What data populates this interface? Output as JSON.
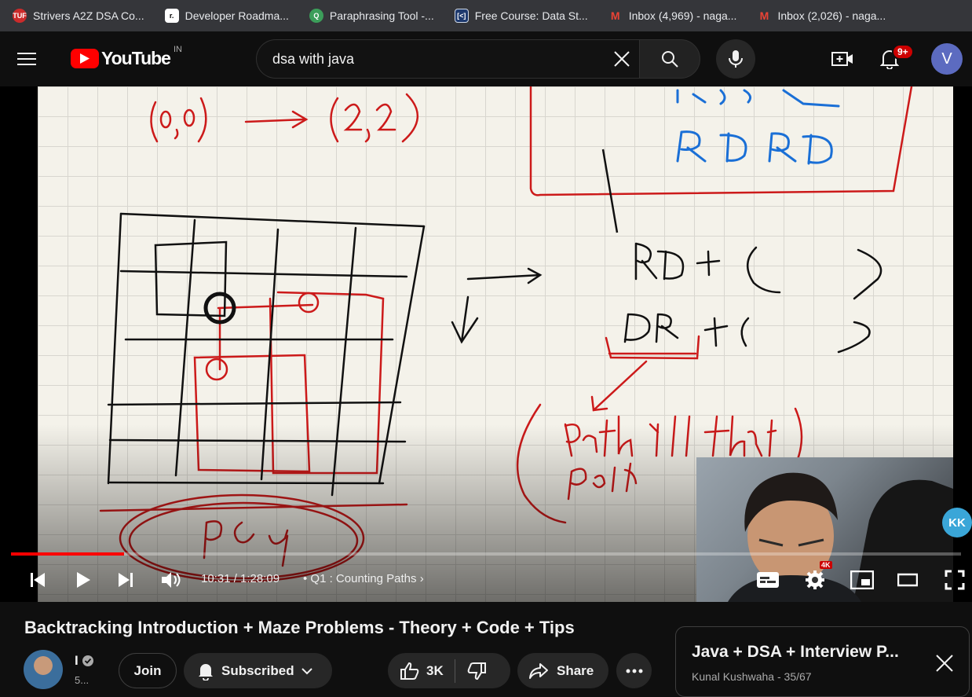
{
  "bookmarks": [
    {
      "label": "Strivers A2Z DSA Co...",
      "icon": "tuf-icon",
      "color": "#cc2b2b"
    },
    {
      "label": "Developer Roadma...",
      "icon": "roadmap-icon",
      "color": "#ffffff"
    },
    {
      "label": "Paraphrasing Tool -...",
      "icon": "quillbot-icon",
      "color": "#3c9e5a"
    },
    {
      "label": "Free Course: Data St...",
      "icon": "course-icon",
      "color": "#1e3a6e"
    },
    {
      "label": "Inbox (4,969) - naga...",
      "icon": "gmail-icon",
      "color": "#ea4335"
    },
    {
      "label": "Inbox (2,026) - naga...",
      "icon": "gmail-icon",
      "color": "#ea4335"
    }
  ],
  "header": {
    "logo_text": "YouTube",
    "country_code": "IN",
    "search_value": "dsa with java",
    "notifications_badge": "9+",
    "avatar_letter": "V"
  },
  "video": {
    "time": "10:31 / 1:28:09",
    "chapter": "Q1 : Counting Paths",
    "quality_badge": "4K",
    "progress": 0.119,
    "channel_logo": "KK"
  },
  "details": {
    "title": "Backtracking Introduction + Maze Problems - Theory + Code + Tips",
    "channel_name": "I",
    "subscribers": "5...",
    "join_label": "Join",
    "subscribed_label": "Subscribed",
    "likes": "3K",
    "share_label": "Share"
  },
  "playlist": {
    "title": "Java + DSA + Interview P...",
    "author": "Kunal Kushwaha",
    "position": "35/67"
  },
  "colors": {
    "accent": "#ff0000",
    "background": "#0f0f0f",
    "ink_red": "#cc1a1a",
    "ink_blue": "#1a6fd6"
  }
}
